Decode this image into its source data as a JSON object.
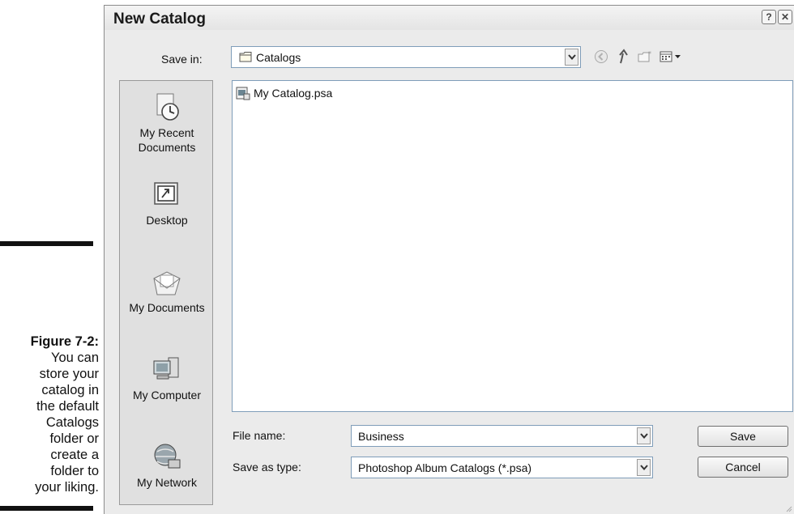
{
  "caption": {
    "figure": "Figure 7-2:",
    "lines": [
      "You can",
      "store your",
      "catalog in",
      "the default",
      "Catalogs",
      "folder or",
      "create a",
      "folder to",
      "your liking."
    ]
  },
  "dialog": {
    "title": "New Catalog",
    "help_icon": "?",
    "close_icon": "✕",
    "save_in_label": "Save in:",
    "save_in_value": "Catalogs",
    "toolbar_icons": [
      "back-icon",
      "up-folder-icon",
      "new-folder-icon",
      "views-menu-icon"
    ]
  },
  "places": [
    {
      "label_line1": "My Recent",
      "label_line2": "Documents",
      "icon": "recent-documents-icon"
    },
    {
      "label_line1": "Desktop",
      "label_line2": "",
      "icon": "desktop-icon"
    },
    {
      "label_line1": "My Documents",
      "label_line2": "",
      "icon": "my-documents-icon"
    },
    {
      "label_line1": "My Computer",
      "label_line2": "",
      "icon": "my-computer-icon"
    },
    {
      "label_line1": "My Network",
      "label_line2": "",
      "icon": "my-network-icon"
    }
  ],
  "files": [
    {
      "name": "My Catalog.psa",
      "icon": "catalog-file-icon"
    }
  ],
  "form": {
    "file_name_label": "File name:",
    "file_name_value": "Business",
    "save_as_type_label": "Save as type:",
    "save_as_type_value": "Photoshop Album Catalogs (*.psa)"
  },
  "buttons": {
    "save": "Save",
    "cancel": "Cancel"
  }
}
